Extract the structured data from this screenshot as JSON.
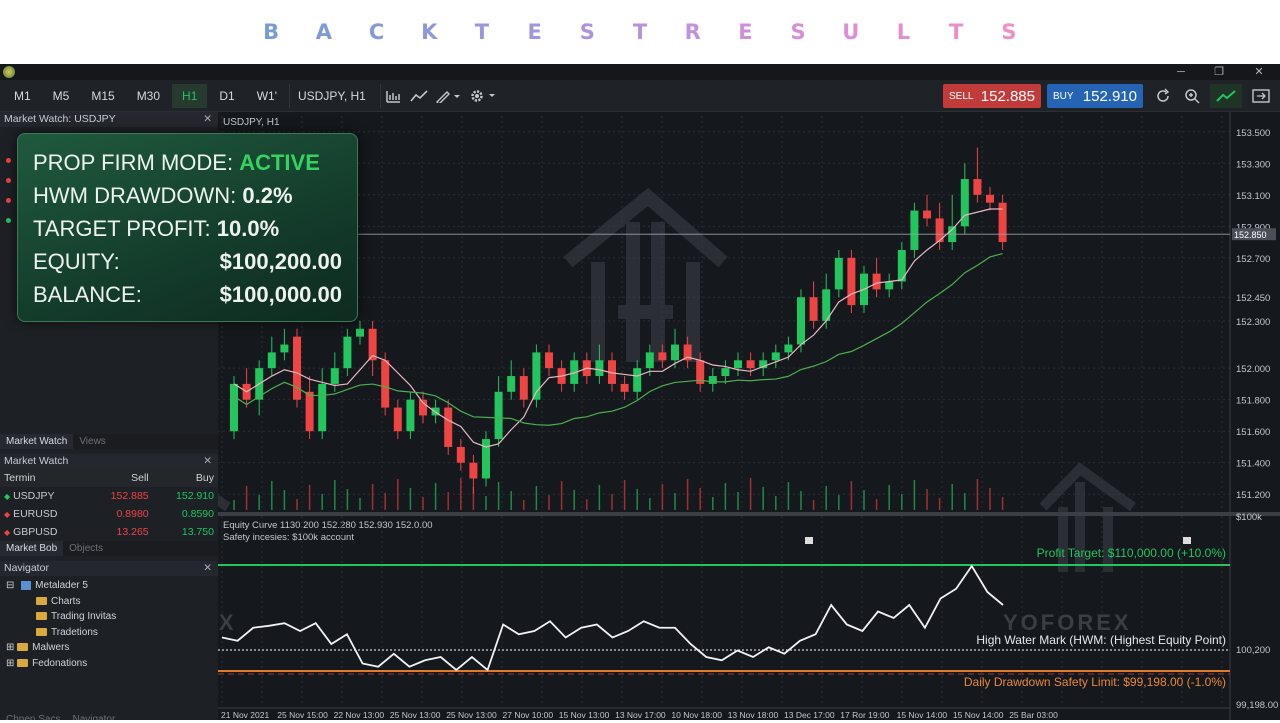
{
  "banner": {
    "letters": [
      "B",
      "A",
      "C",
      "K",
      "T",
      "E",
      "S",
      "T",
      "R",
      "E",
      "S",
      "U",
      "L",
      "T",
      "S"
    ],
    "colors": [
      "#7a9bd8",
      "#7e9ad8",
      "#869ad9",
      "#8e98da",
      "#9897dc",
      "#a295dd",
      "#ad94de",
      "#b892de",
      "#c291dd",
      "#cc90db",
      "#d58fd8",
      "#dc8fd4",
      "#e38fcf",
      "#e990c9",
      "#ee91c3"
    ]
  },
  "toolbar": {
    "timeframes": [
      "M1",
      "M5",
      "M15",
      "M30",
      "H1",
      "D1",
      "W1'"
    ],
    "active_timeframe": "H1",
    "symbol": "USDJPY, H1",
    "sell_label": "SELL",
    "sell_price": "152.885",
    "buy_label": "BUY",
    "buy_price": "152.910"
  },
  "market_watch_top": {
    "title": "Market Watch: USDJPY",
    "tabs": [
      "Market Watch",
      "Views"
    ]
  },
  "market_watch": {
    "title": "Market Watch",
    "headers": [
      "Termin",
      "Sell",
      "Buy"
    ],
    "rows": [
      {
        "symbol": "USDJPY",
        "sell": "152.885",
        "buy": "152.910",
        "dot": "#22c55e"
      },
      {
        "symbol": "EURUSD",
        "sell": "0.8980",
        "buy": "0.8590",
        "dot": "#ef4444"
      },
      {
        "symbol": "GBPUSD",
        "sell": "13.265",
        "buy": "13.750",
        "dot": "#ef4444"
      }
    ],
    "tabs": [
      "Market Bob",
      "Objects"
    ]
  },
  "navigator": {
    "title": "Navigator",
    "items": [
      "Metalader 5",
      "Charts",
      "Trading Invitas",
      "Tradetions",
      "Malwers",
      "Fedonations"
    ],
    "bottom_tabs": [
      "Chnen Sacs",
      "Navigator"
    ]
  },
  "overlay": {
    "mode_label": "PROP FIRM MODE:",
    "mode_value": "ACTIVE",
    "hwm_label": "HWM DRAWDOWN:",
    "hwm_value": "0.2%",
    "target_label": "TARGET PROFIT:",
    "target_value": "10.0%",
    "equity_label": "EQUITY:",
    "equity_value": "$100,200.00",
    "balance_label": "BALANCE:",
    "balance_value": "$100,000.00"
  },
  "price_chart": {
    "label": "USDJPY, H1",
    "current_price": "152.850",
    "y_ticks": [
      "153.500",
      "153.300",
      "153.100",
      "152.900",
      "152.700",
      "152.450",
      "152.300",
      "152.000",
      "151.800",
      "151.600",
      "151.400",
      "151.200"
    ],
    "candles": [
      [
        151.6,
        151.9,
        151.55,
        151.95
      ],
      [
        151.9,
        151.8,
        151.75,
        152.0
      ],
      [
        151.8,
        152.0,
        151.7,
        152.05
      ],
      [
        152.0,
        152.1,
        151.95,
        152.2
      ],
      [
        152.1,
        152.15,
        152.05,
        152.25
      ],
      [
        152.2,
        151.8,
        151.75,
        152.25
      ],
      [
        151.85,
        151.6,
        151.55,
        151.95
      ],
      [
        151.6,
        151.9,
        151.55,
        152.0
      ],
      [
        151.9,
        152.0,
        151.85,
        152.1
      ],
      [
        152.0,
        152.2,
        151.95,
        152.25
      ],
      [
        152.2,
        152.25,
        152.15,
        152.3
      ],
      [
        152.25,
        152.05,
        151.95,
        152.3
      ],
      [
        152.05,
        151.75,
        151.7,
        152.1
      ],
      [
        151.75,
        151.6,
        151.55,
        151.8
      ],
      [
        151.6,
        151.8,
        151.55,
        151.85
      ],
      [
        151.8,
        151.7,
        151.65,
        151.85
      ],
      [
        151.7,
        151.75,
        151.65,
        151.8
      ],
      [
        151.75,
        151.5,
        151.45,
        151.8
      ],
      [
        151.5,
        151.4,
        151.35,
        151.55
      ],
      [
        151.4,
        151.3,
        151.2,
        151.45
      ],
      [
        151.3,
        151.55,
        151.25,
        151.6
      ],
      [
        151.55,
        151.85,
        151.5,
        151.95
      ],
      [
        151.85,
        151.95,
        151.8,
        152.05
      ],
      [
        151.95,
        151.8,
        151.75,
        152.0
      ],
      [
        151.8,
        152.1,
        151.75,
        152.15
      ],
      [
        152.1,
        152.0,
        151.95,
        152.15
      ],
      [
        152.0,
        151.9,
        151.85,
        152.05
      ],
      [
        151.9,
        152.05,
        151.85,
        152.1
      ],
      [
        152.05,
        151.95,
        151.9,
        152.1
      ],
      [
        151.95,
        152.05,
        151.9,
        152.15
      ],
      [
        152.05,
        151.9,
        151.85,
        152.1
      ],
      [
        151.9,
        151.85,
        151.8,
        151.95
      ],
      [
        151.85,
        152.0,
        151.8,
        152.05
      ],
      [
        152.0,
        152.1,
        151.95,
        152.15
      ],
      [
        152.1,
        152.05,
        152.0,
        152.15
      ],
      [
        152.05,
        152.15,
        152.0,
        152.25
      ],
      [
        152.15,
        152.05,
        152.0,
        152.2
      ],
      [
        152.05,
        151.9,
        151.85,
        152.1
      ],
      [
        151.9,
        151.95,
        151.85,
        152.0
      ],
      [
        151.95,
        152.0,
        151.9,
        152.05
      ],
      [
        152.0,
        152.05,
        151.95,
        152.1
      ],
      [
        152.05,
        152.0,
        151.95,
        152.1
      ],
      [
        152.0,
        152.05,
        151.95,
        152.1
      ],
      [
        152.05,
        152.1,
        152.0,
        152.15
      ],
      [
        152.1,
        152.15,
        152.05,
        152.2
      ],
      [
        152.15,
        152.45,
        152.1,
        152.5
      ],
      [
        152.45,
        152.3,
        152.25,
        152.55
      ],
      [
        152.3,
        152.5,
        152.25,
        152.6
      ],
      [
        152.5,
        152.7,
        152.45,
        152.75
      ],
      [
        152.7,
        152.4,
        152.35,
        152.75
      ],
      [
        152.4,
        152.6,
        152.35,
        152.65
      ],
      [
        152.6,
        152.5,
        152.45,
        152.7
      ],
      [
        152.5,
        152.55,
        152.45,
        152.6
      ],
      [
        152.55,
        152.75,
        152.5,
        152.8
      ],
      [
        152.75,
        153.0,
        152.7,
        153.05
      ],
      [
        153.0,
        152.95,
        152.9,
        153.1
      ],
      [
        152.95,
        152.8,
        152.75,
        153.05
      ],
      [
        152.8,
        152.9,
        152.75,
        153.1
      ],
      [
        152.9,
        153.2,
        152.85,
        153.3
      ],
      [
        153.2,
        153.1,
        153.05,
        153.4
      ],
      [
        153.1,
        153.05,
        153.0,
        153.15
      ],
      [
        153.05,
        152.8,
        152.75,
        153.1
      ]
    ]
  },
  "equity_chart": {
    "title": "Equity Curve 1130.200 152.280 152.930 152.0.00",
    "subtitle": "Safety incesies: $100k account",
    "profit_target_label": "Profit Target: $110,000.00 (+10.0%)",
    "hwm_label": "High Water Mark (HWM: (Highest Equity Point)",
    "drawdown_label": "Daily Drawdown Safety Limit: $99,198.00 (-1.0%)",
    "y_ticks": [
      "$100k",
      "100,200",
      "99,198.00"
    ],
    "x_ticks": [
      "21 Nov 2021",
      "25 Nov 15:00",
      "22 Nov 13:00",
      "25 Nov 13:00",
      "25 Nov 13:00",
      "27 Nov 10:00",
      "15 Nov 13:00",
      "13 Nov 17:00",
      "10 Nov 18:00",
      "13 Nov 18:00",
      "13 Dec 17:00",
      "17 Ror 19:00",
      "15 Nov 14:00",
      "15 Nov 14:00",
      "25 Bar 03:00"
    ],
    "values": [
      100200,
      100150,
      100350,
      100380,
      100420,
      100300,
      100420,
      100100,
      100250,
      99800,
      99750,
      99950,
      99750,
      99850,
      99900,
      99700,
      99900,
      99700,
      100400,
      100250,
      100300,
      100450,
      100200,
      100350,
      100400,
      100200,
      100300,
      100450,
      100350,
      100350,
      100100,
      99900,
      99850,
      100000,
      99900,
      100050,
      99950,
      100150,
      100250,
      100700,
      100400,
      100300,
      100600,
      100500,
      100700,
      100350,
      100800,
      100950,
      101300,
      100900,
      100700
    ]
  }
}
